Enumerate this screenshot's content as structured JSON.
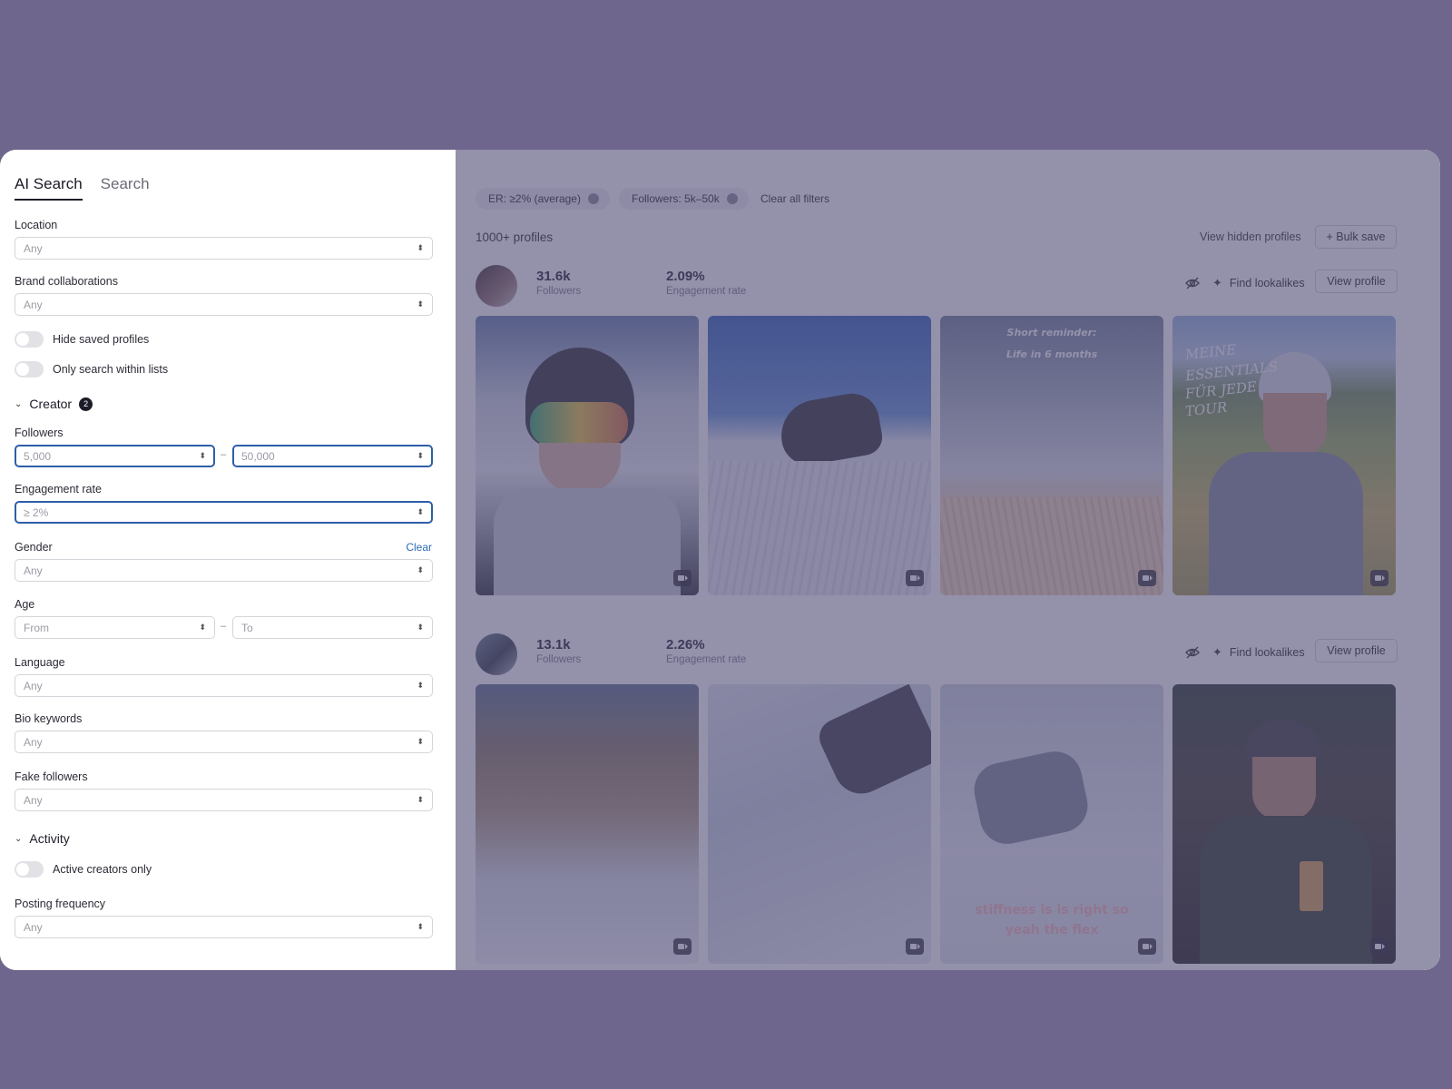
{
  "tabs": [
    {
      "label": "AI Search",
      "active": true
    },
    {
      "label": "Search",
      "active": false
    }
  ],
  "filters": {
    "location": {
      "label": "Location",
      "value": "Any"
    },
    "brand_collaborations": {
      "label": "Brand collaborations",
      "value": "Any"
    },
    "hide_saved": {
      "label": "Hide saved profiles",
      "on": false
    },
    "only_lists": {
      "label": "Only search within lists",
      "on": false
    },
    "creator_section": {
      "label": "Creator",
      "count": "2"
    },
    "followers": {
      "label": "Followers",
      "min_placeholder": "5,000",
      "max_placeholder": "50,000",
      "separator": "–"
    },
    "engagement_rate": {
      "label": "Engagement rate",
      "value": "≥ 2%"
    },
    "gender": {
      "label": "Gender",
      "value": "Any",
      "clear_label": "Clear"
    },
    "age": {
      "label": "Age",
      "from_placeholder": "From",
      "to_placeholder": "To",
      "separator": "–"
    },
    "language": {
      "label": "Language",
      "value": "Any"
    },
    "bio_keywords": {
      "label": "Bio keywords",
      "value": "Any"
    },
    "fake_followers": {
      "label": "Fake followers",
      "value": "Any"
    },
    "activity_section": {
      "label": "Activity"
    },
    "active_only": {
      "label": "Active creators only",
      "on": false
    },
    "posting_frequency": {
      "label": "Posting frequency",
      "value": "Any"
    }
  },
  "results": {
    "chips": [
      "ER: ≥2% (average)",
      "Followers: 5k–50k"
    ],
    "clear_all": "Clear all filters",
    "count_label": "1000+ profiles",
    "view_hidden": "View hidden profiles",
    "bulk_save": "+ Bulk save",
    "profiles": [
      {
        "followers": "31.6k",
        "followers_label": "Followers",
        "engagement": "2.09%",
        "engagement_label": "Engagement rate",
        "find_lookalikes": "Find lookalikes",
        "view_profile": "View profile",
        "posts": [
          {
            "overlay_text": ""
          },
          {
            "overlay_text": ""
          },
          {
            "overlay_line1": "Short reminder:",
            "overlay_line2": "Life in 6 months"
          },
          {
            "overlay_line1": "MEINE",
            "overlay_line2": "ESSENTIALS",
            "overlay_line3": "FÜR JEDE",
            "overlay_line4": "TOUR"
          }
        ]
      },
      {
        "followers": "13.1k",
        "followers_label": "Followers",
        "engagement": "2.26%",
        "engagement_label": "Engagement rate",
        "find_lookalikes": "Find lookalikes",
        "view_profile": "View profile",
        "posts": [
          {
            "overlay_text": ""
          },
          {
            "overlay_text": ""
          },
          {
            "overlay_line1": "stiffness is is right so",
            "overlay_line2": "yeah the flex"
          },
          {
            "overlay_text": ""
          }
        ]
      }
    ]
  },
  "colors": {
    "backdrop": "#6f668e",
    "accent_blue": "#2d5fa8",
    "link_blue": "#2d6bb5"
  }
}
